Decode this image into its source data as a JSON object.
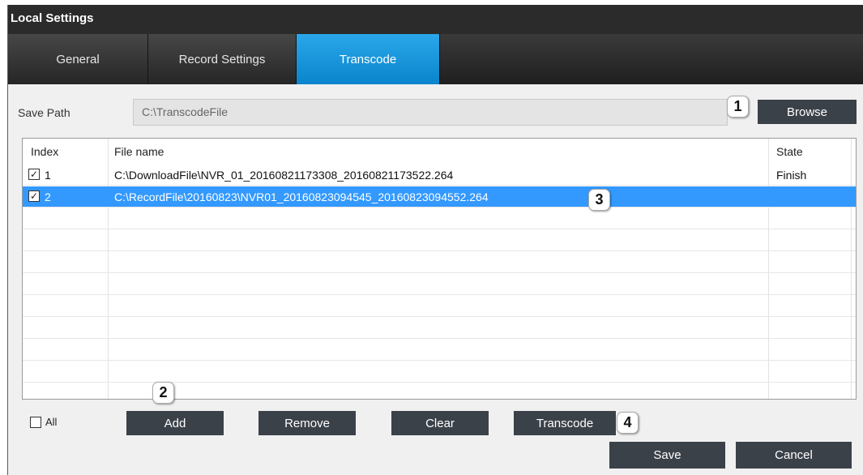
{
  "window": {
    "title": "Local Settings"
  },
  "tabs": [
    {
      "label": "General"
    },
    {
      "label": "Record Settings"
    },
    {
      "label": "Transcode"
    }
  ],
  "save_path": {
    "label": "Save Path",
    "value": "C:\\TranscodeFile",
    "browse_label": "Browse"
  },
  "table": {
    "headers": {
      "index": "Index",
      "file_name": "File name",
      "state": "State"
    },
    "rows": [
      {
        "index": "1",
        "checked": true,
        "file_name": "C:\\DownloadFile\\NVR_01_20160821173308_20160821173522.264",
        "state": "Finish"
      },
      {
        "index": "2",
        "checked": true,
        "file_name": "C:\\RecordFile\\20160823\\NVR01_20160823094545_20160823094552.264",
        "state": ""
      }
    ],
    "selected_row": 2
  },
  "footer": {
    "all_label": "All",
    "add_label": "Add",
    "remove_label": "Remove",
    "clear_label": "Clear",
    "transcode_label": "Transcode",
    "save_label": "Save",
    "cancel_label": "Cancel"
  },
  "callouts": {
    "c1": "1",
    "c2": "2",
    "c3": "3",
    "c4": "4"
  },
  "colors": {
    "accent_tab": "#1396dd",
    "selection": "#3399ff",
    "button": "#3b4149",
    "titlebar": "#2b2b2b"
  }
}
